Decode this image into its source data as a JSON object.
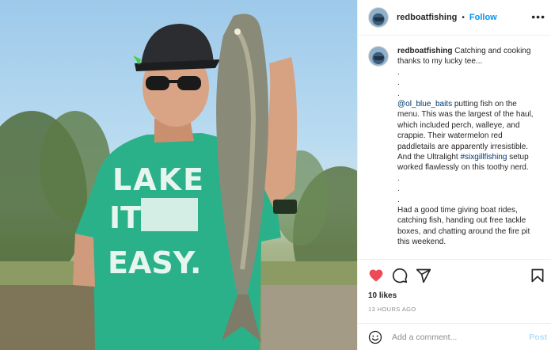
{
  "header": {
    "username": "redboatfishing",
    "separator": "•",
    "follow_label": "Follow",
    "more_glyph": "•••"
  },
  "caption": {
    "username": "redboatfishing",
    "intro": "Catching and cooking thanks to my lucky tee...",
    "dot1": ".",
    "dot2": ".",
    "dot3": ".",
    "mention": "@ol_blue_baits",
    "para1": "putting fish on the menu. This was the largest of the haul, which included perch, walleye, and crappie. Their watermelon red paddletails are apparently irresistible. And the Ultralight",
    "hashtag": "#sixgillfishing",
    "para1_end": "setup worked flawlessly on this toothy nerd.",
    "dot4": ".",
    "dot5": ".",
    "dot6": ".",
    "para2": "Had a good time giving boat rides, catching fish, handing out free tackle boxes, and chatting around the fire pit this weekend."
  },
  "photo": {
    "shirt_text_1": "LAKE",
    "shirt_text_2": "IT",
    "shirt_text_3": "EASY."
  },
  "actions": {
    "like_icon": "heart-filled-icon",
    "comment_icon": "comment-icon",
    "share_icon": "paper-plane-icon",
    "save_icon": "bookmark-icon",
    "like_color": "#ed4956"
  },
  "likes": "10 likes",
  "time_ago": "13 HOURS AGO",
  "comment_box": {
    "placeholder": "Add a comment...",
    "post_label": "Post",
    "emoji_icon": "smiley-icon"
  }
}
